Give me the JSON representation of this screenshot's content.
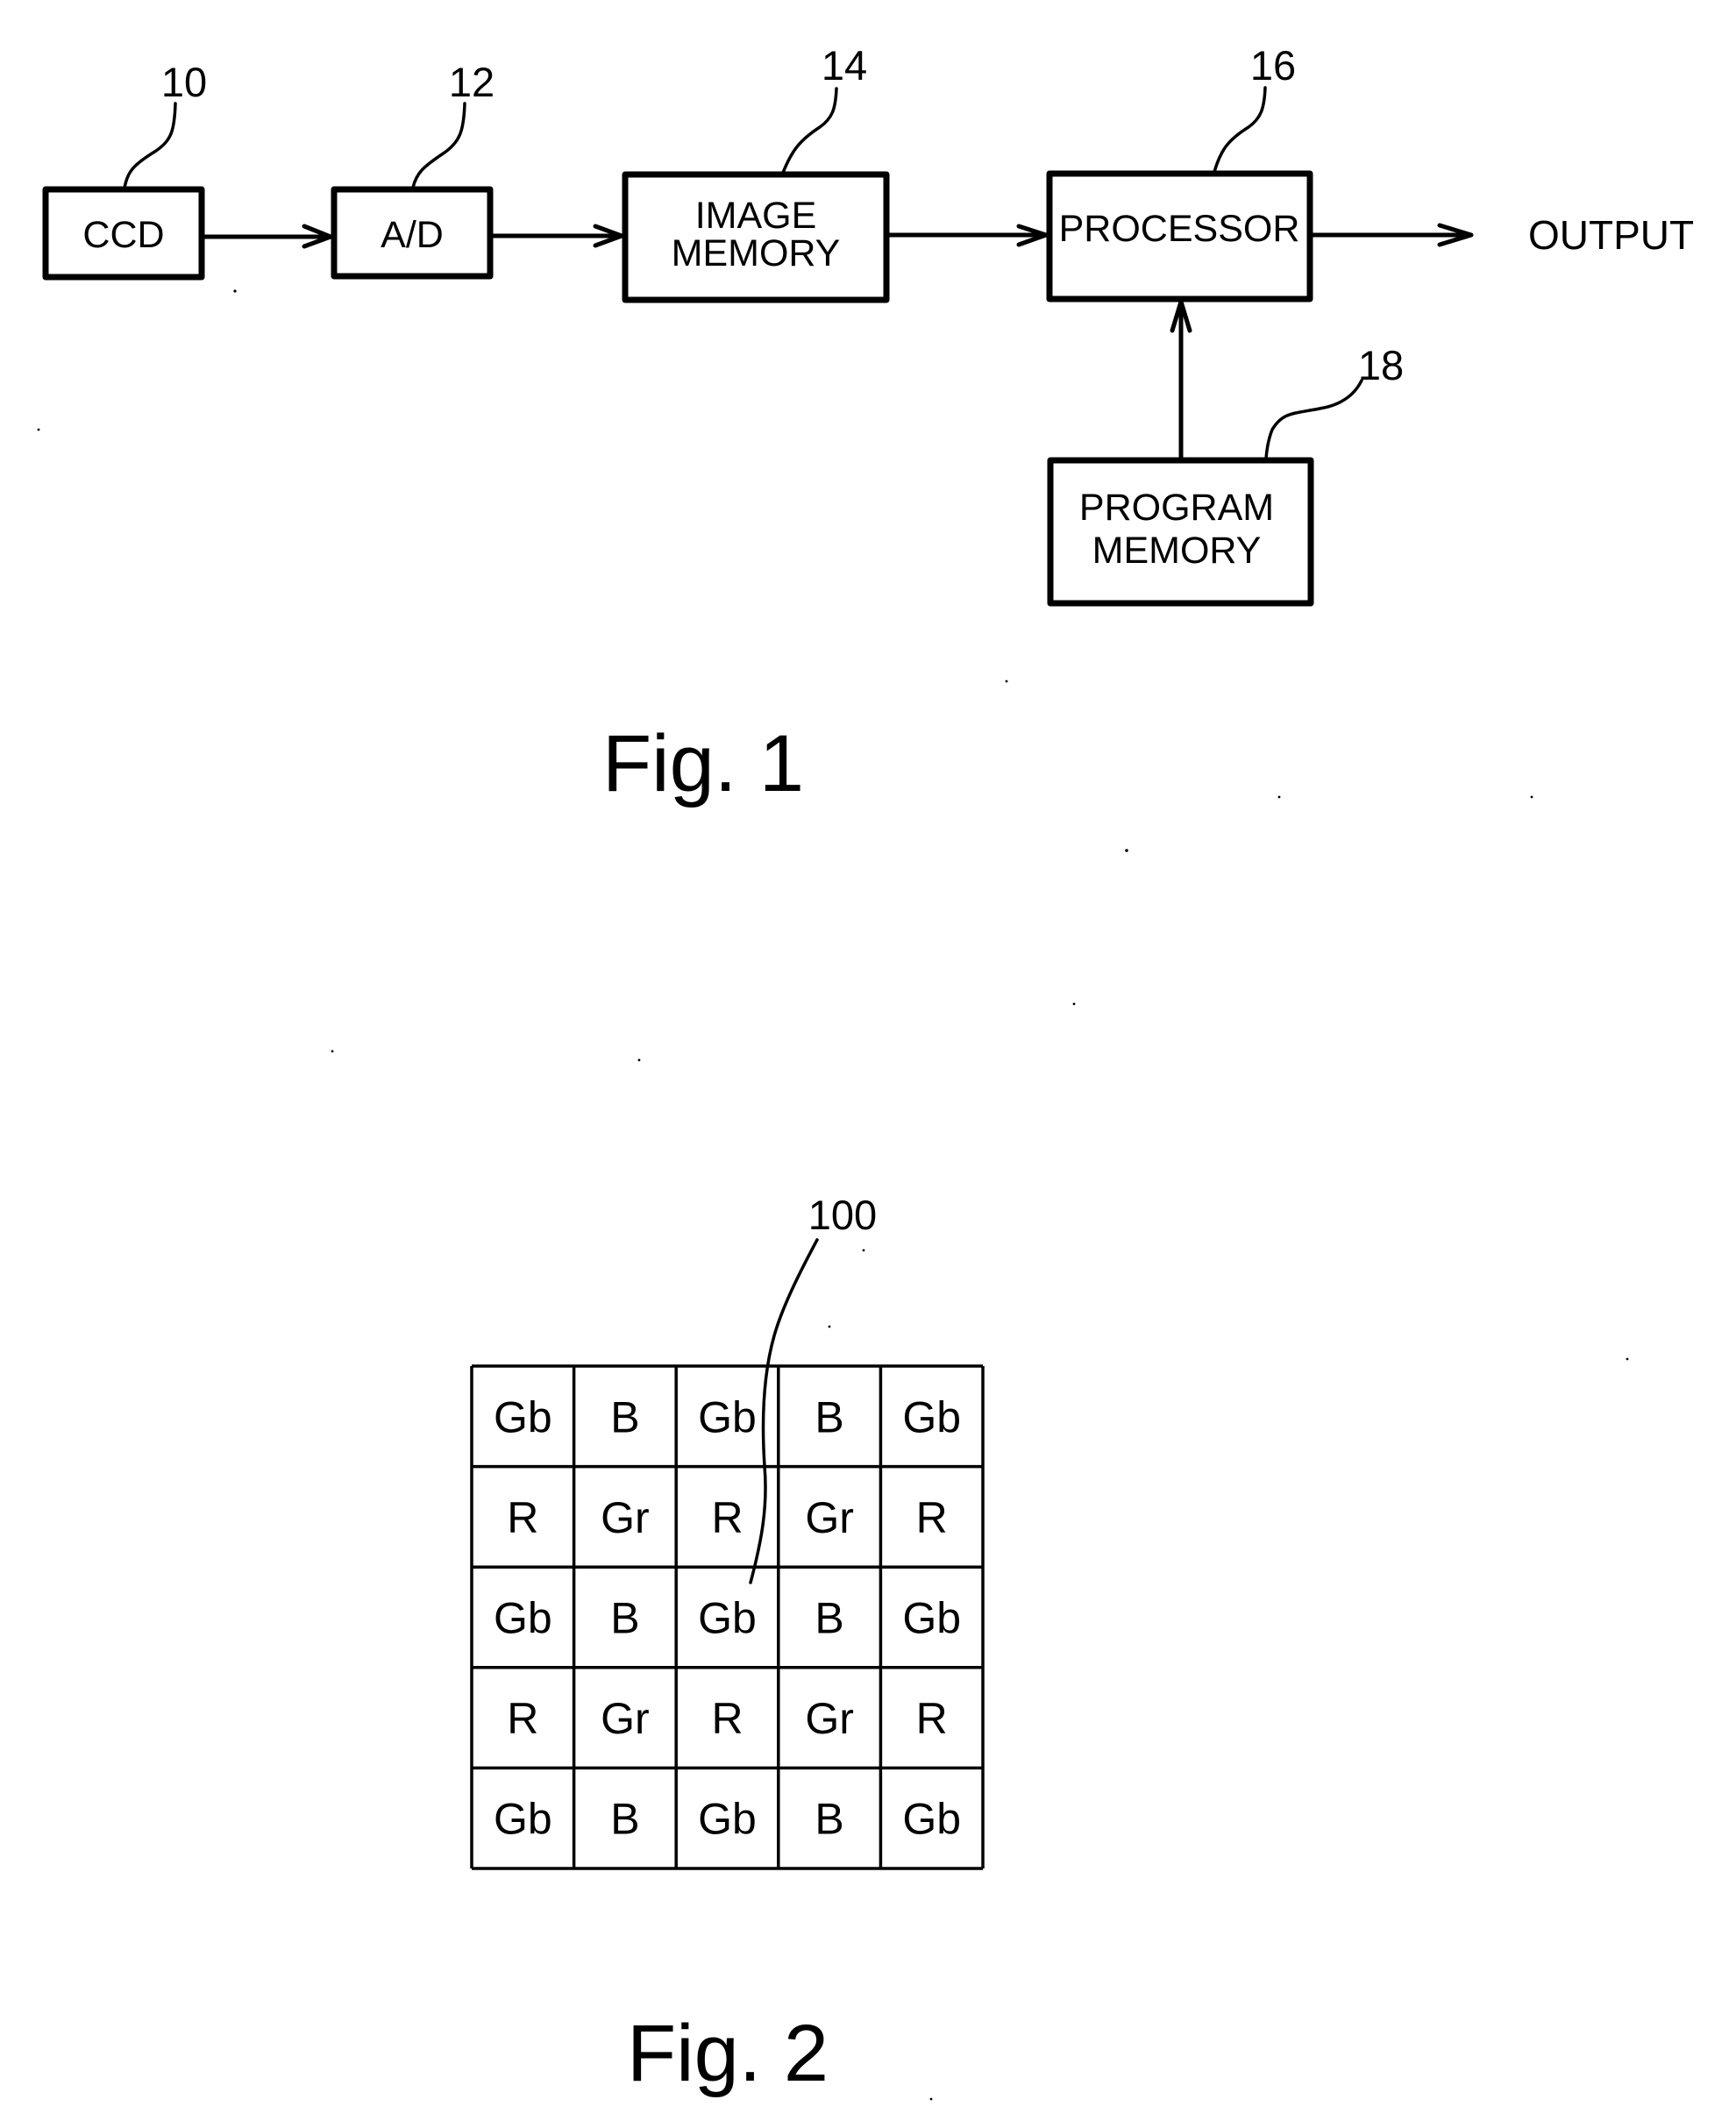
{
  "figure1": {
    "caption": "Fig. 1",
    "blocks": {
      "ccd": {
        "label": "CCD",
        "ref": "10"
      },
      "ad": {
        "label": "A/D",
        "ref": "12"
      },
      "image_memory": {
        "label_line1": "IMAGE",
        "label_line2": "MEMORY",
        "ref": "14"
      },
      "processor": {
        "label": "PROCESSOR",
        "ref": "16"
      },
      "program_memory": {
        "label_line1": "PROGRAM",
        "label_line2": "MEMORY",
        "ref": "18"
      }
    },
    "output_label": "OUTPUT",
    "connections": [
      {
        "from": "CCD",
        "to": "A/D"
      },
      {
        "from": "A/D",
        "to": "IMAGE MEMORY"
      },
      {
        "from": "IMAGE MEMORY",
        "to": "PROCESSOR"
      },
      {
        "from": "PROGRAM MEMORY",
        "to": "PROCESSOR"
      },
      {
        "from": "PROCESSOR",
        "to": "OUTPUT"
      }
    ]
  },
  "figure2": {
    "caption": "Fig. 2",
    "ref": "100",
    "pixel_grid": [
      [
        "Gb",
        "B",
        "Gb",
        "B",
        "Gb"
      ],
      [
        "R",
        "Gr",
        "R",
        "Gr",
        "R"
      ],
      [
        "Gb",
        "B",
        "Gb",
        "B",
        "Gb"
      ],
      [
        "R",
        "Gr",
        "R",
        "Gr",
        "R"
      ],
      [
        "Gb",
        "B",
        "Gb",
        "B",
        "Gb"
      ]
    ],
    "ref_points_to": {
      "row": 2,
      "col": 2
    }
  }
}
